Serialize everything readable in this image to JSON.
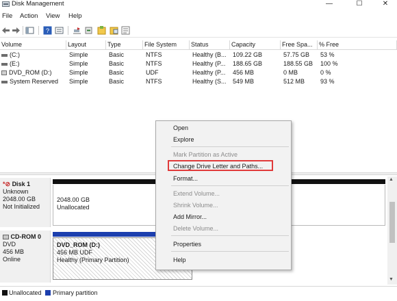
{
  "window": {
    "title": "Disk Management",
    "controls": {
      "minimize": "—",
      "maximize": "☐",
      "close": "✕"
    }
  },
  "menu": [
    "File",
    "Action",
    "View",
    "Help"
  ],
  "toolbar": {
    "icons": [
      "back-icon",
      "forward-icon",
      "console-tree-icon",
      "help-icon",
      "properties-icon",
      "refresh-icon",
      "rescan-icon",
      "new-volume-icon",
      "export-icon"
    ]
  },
  "volume_table": {
    "columns": [
      "Volume",
      "Layout",
      "Type",
      "File System",
      "Status",
      "Capacity",
      "Free Spa...",
      "% Free"
    ],
    "rows": [
      [
        "(C:)",
        "Simple",
        "Basic",
        "NTFS",
        "Healthy (B...",
        "109.22 GB",
        "57.75 GB",
        "53 %"
      ],
      [
        "(E:)",
        "Simple",
        "Basic",
        "NTFS",
        "Healthy (P...",
        "188.65 GB",
        "188.55 GB",
        "100 %"
      ],
      [
        "DVD_ROM (D:)",
        "Simple",
        "Basic",
        "UDF",
        "Healthy (P...",
        "456 MB",
        "0 MB",
        "0 %"
      ],
      [
        "System Reserved",
        "Simple",
        "Basic",
        "NTFS",
        "Healthy (S...",
        "549 MB",
        "512 MB",
        "93 %"
      ]
    ]
  },
  "disks": [
    {
      "name": "Disk 1",
      "type": "Unknown",
      "size": "2048.00 GB",
      "state": "Not Initialized",
      "partition": {
        "size": "2048.00 GB",
        "status": "Unallocated"
      }
    },
    {
      "name": "CD-ROM 0",
      "type": "DVD",
      "size": "456 MB",
      "state": "Online",
      "partition": {
        "label": "DVD_ROM  (D:)",
        "size": "456 MB UDF",
        "status": "Healthy (Primary Partition)"
      }
    }
  ],
  "legend": {
    "items": [
      {
        "label": "Unallocated",
        "color": "#111111"
      },
      {
        "label": "Primary partition",
        "color": "#1c3fae"
      }
    ]
  },
  "context_menu": {
    "items": [
      {
        "label": "Open",
        "enabled": true
      },
      {
        "label": "Explore",
        "enabled": true
      },
      {
        "label": "Mark Partition as Active",
        "enabled": false
      },
      {
        "label": "Change Drive Letter and Paths...",
        "enabled": true,
        "highlighted": true
      },
      {
        "label": "Format...",
        "enabled": true
      },
      {
        "label": "Extend Volume...",
        "enabled": false
      },
      {
        "label": "Shrink Volume...",
        "enabled": false
      },
      {
        "label": "Add Mirror...",
        "enabled": true
      },
      {
        "label": "Delete Volume...",
        "enabled": false
      },
      {
        "label": "Properties",
        "enabled": true
      },
      {
        "label": "Help",
        "enabled": true
      }
    ],
    "highlight_color": "#e03a3a"
  }
}
